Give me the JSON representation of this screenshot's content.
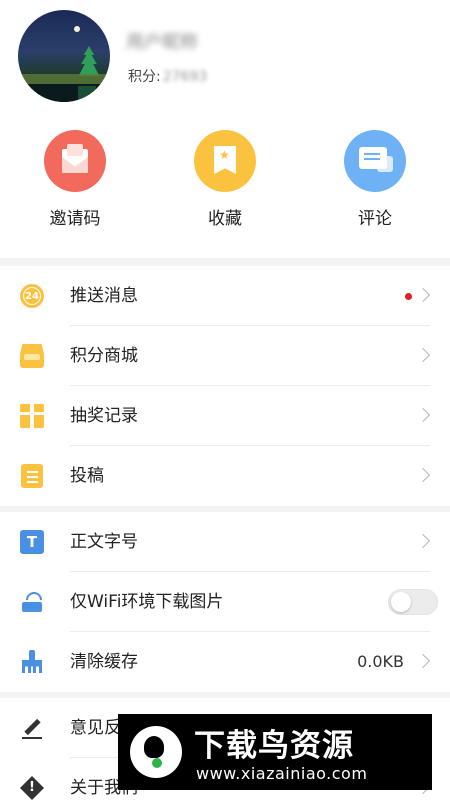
{
  "profile": {
    "username": "用户昵称",
    "points_label": "积分:",
    "points_value": "27693"
  },
  "quick_actions": [
    {
      "label": "邀请码",
      "icon": "envelope-icon",
      "color": "#f26a5c"
    },
    {
      "label": "收藏",
      "icon": "bookmark-star-icon",
      "color": "#fbc23f"
    },
    {
      "label": "评论",
      "icon": "chat-bubbles-icon",
      "color": "#6fb1f5"
    }
  ],
  "menu_group_1": [
    {
      "label": "推送消息",
      "icon": "clock-24-icon",
      "badge": "24",
      "has_red_dot": true
    },
    {
      "label": "积分商城",
      "icon": "shop-icon"
    },
    {
      "label": "抽奖记录",
      "icon": "gift-icon"
    },
    {
      "label": "投稿",
      "icon": "document-icon"
    }
  ],
  "menu_group_2": [
    {
      "label": "正文字号",
      "icon": "text-size-icon",
      "glyph": "T"
    },
    {
      "label": "仅WiFi环境下载图片",
      "icon": "wifi-router-icon",
      "toggle": "off"
    },
    {
      "label": "清除缓存",
      "icon": "broom-icon",
      "value": "0.0KB"
    }
  ],
  "menu_group_3": [
    {
      "label": "意见反馈",
      "icon": "pencil-icon"
    },
    {
      "label": "关于我们",
      "icon": "info-diamond-icon",
      "glyph": "!"
    }
  ],
  "watermark": {
    "title": "下载鸟资源",
    "url": "www.xiazainiao.com"
  },
  "colors": {
    "accent_yellow": "#fbc23f",
    "accent_blue": "#4a90e2",
    "red_dot": "#e02020"
  }
}
